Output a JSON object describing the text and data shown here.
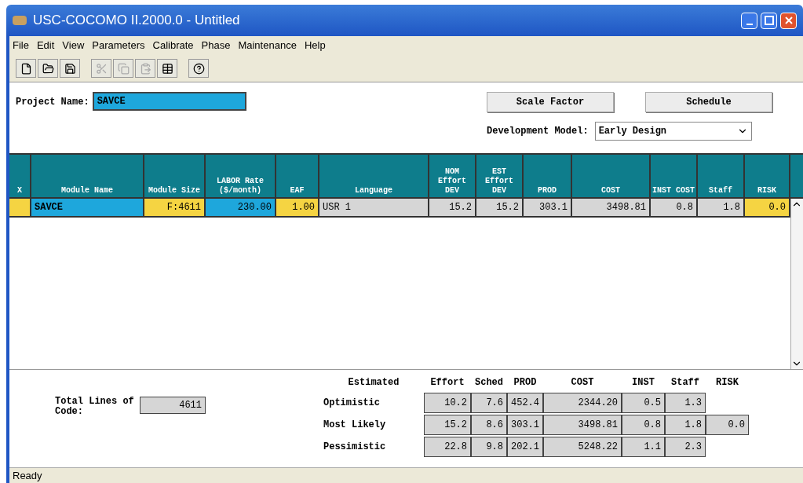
{
  "window": {
    "title": "USC-COCOMO II.2000.0 - Untitled"
  },
  "menu": [
    "File",
    "Edit",
    "View",
    "Parameters",
    "Calibrate",
    "Phase",
    "Maintenance",
    "Help"
  ],
  "toolbar": [
    {
      "kind": "new",
      "disabled": false
    },
    {
      "kind": "open",
      "disabled": false
    },
    {
      "kind": "save",
      "disabled": false
    },
    {
      "kind": "cut",
      "disabled": true
    },
    {
      "kind": "copy",
      "disabled": true
    },
    {
      "kind": "paste",
      "disabled": true
    },
    {
      "kind": "grid",
      "disabled": false
    },
    {
      "kind": "help",
      "disabled": false
    }
  ],
  "project": {
    "label": "Project Name:",
    "value": "SAVCE"
  },
  "buttons": [
    "Scale Factor",
    "Schedule"
  ],
  "model": {
    "label": "Development Model:",
    "value": "Early Design"
  },
  "table": {
    "columns": [
      "X",
      "Module Name",
      "Module Size",
      "LABOR Rate ($/month)",
      "EAF",
      "Language",
      "NOM Effort DEV",
      "EST Effort DEV",
      "PROD",
      "COST",
      "INST COST",
      "Staff",
      "RISK"
    ],
    "rows": [
      {
        "cells": [
          {
            "color": "#f5d442"
          },
          {
            "text": "SAVCE",
            "color": "#1ea7dc"
          },
          {
            "text": "F:4611",
            "color": "#f5d442"
          },
          {
            "text": "230.00",
            "color": "#1ea7dc"
          },
          {
            "text": "1.00",
            "color": "#f5d442"
          },
          {
            "text": "USR 1",
            "color": "#d6d6d6"
          },
          {
            "text": "15.2",
            "color": "#d6d6d6"
          },
          {
            "text": "15.2",
            "color": "#d6d6d6"
          },
          {
            "text": "303.1",
            "color": "#d6d6d6"
          },
          {
            "text": "3498.81",
            "color": "#d6d6d6"
          },
          {
            "text": "0.8",
            "color": "#d6d6d6"
          },
          {
            "text": "1.8",
            "color": "#d6d6d6"
          },
          {
            "text": "0.0",
            "color": "#f5d442"
          }
        ]
      }
    ]
  },
  "totals": {
    "label": "Total Lines of Code:",
    "value": "4611"
  },
  "estimates": {
    "columns": [
      "Estimated",
      "Effort",
      "Sched",
      "PROD",
      "COST",
      "INST",
      "Staff",
      "RISK"
    ],
    "rows": [
      {
        "label": "Optimistic",
        "values": [
          "10.2",
          "7.6",
          "452.4",
          "2344.20",
          "0.5",
          "1.3"
        ]
      },
      {
        "label": "Most Likely",
        "values": [
          "15.2",
          "8.6",
          "303.1",
          "3498.81",
          "0.8",
          "1.8",
          "0.0"
        ]
      },
      {
        "label": "Pessimistic",
        "values": [
          "22.8",
          "9.8",
          "202.1",
          "5248.22",
          "1.1",
          "2.3"
        ]
      }
    ]
  },
  "status_bar": "Ready"
}
